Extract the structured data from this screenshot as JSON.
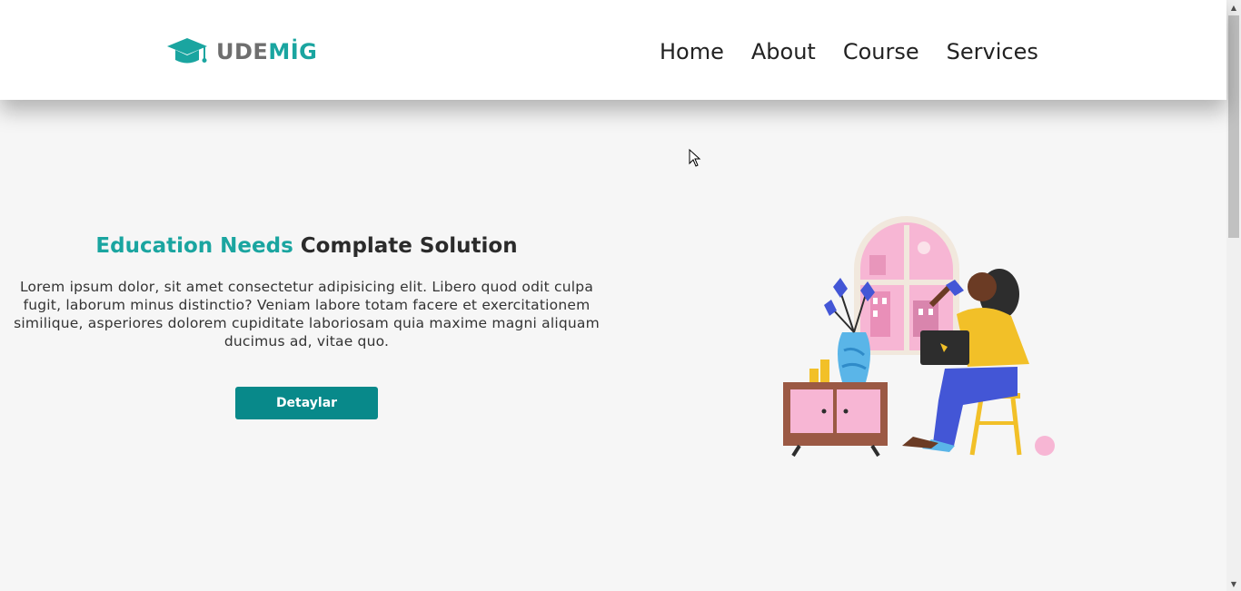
{
  "brand": {
    "logo_part1": "UDE",
    "logo_part2": "MİG",
    "icon": "graduation-cap-icon"
  },
  "nav": {
    "items": [
      "Home",
      "About",
      "Course",
      "Services"
    ]
  },
  "hero": {
    "headline_accent": "Education Needs",
    "headline_rest": "Complate Solution",
    "description": "Lorem ipsum dolor, sit amet consectetur adipisicing elit. Libero quod odit culpa fugit, laborum minus distinctio? Veniam labore totam facere et exercitationem similique, asperiores dolorem cupiditate laboriosam quia maxime magni aliquam ducimus ad, vitae quo.",
    "button_label": "Detaylar"
  },
  "colors": {
    "accent": "#1aa5a0",
    "button": "#08898a",
    "background": "#f6f6f6",
    "heading_dark": "#2b2b2b"
  }
}
